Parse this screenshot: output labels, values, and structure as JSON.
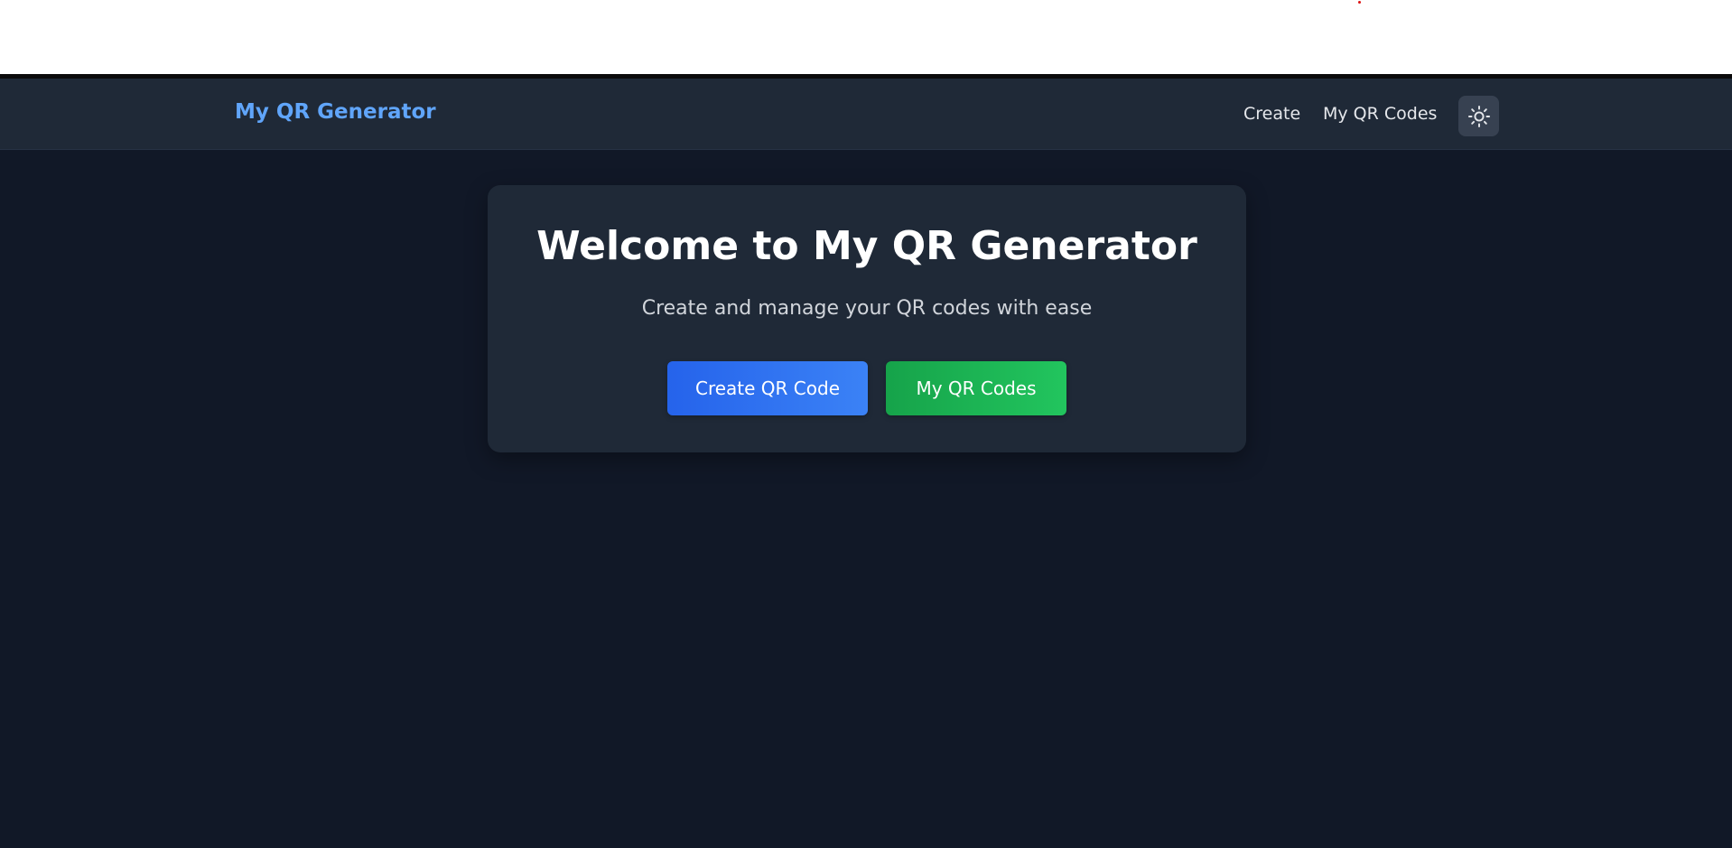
{
  "navbar": {
    "brand": "My QR Generator",
    "links": [
      "Create",
      "My QR Codes"
    ],
    "theme_toggle_icon": "sun-icon"
  },
  "hero": {
    "title": "Welcome to My QR Generator",
    "subtitle": "Create and manage your QR codes with ease",
    "primary_button": "Create QR Code",
    "secondary_button": "My QR Codes"
  },
  "colors": {
    "page_bg": "#111827",
    "navbar_bg": "#1f2937",
    "card_bg": "#1f2937",
    "brand": "#60a5fa",
    "primary": "#2563eb",
    "secondary": "#16a34a"
  }
}
